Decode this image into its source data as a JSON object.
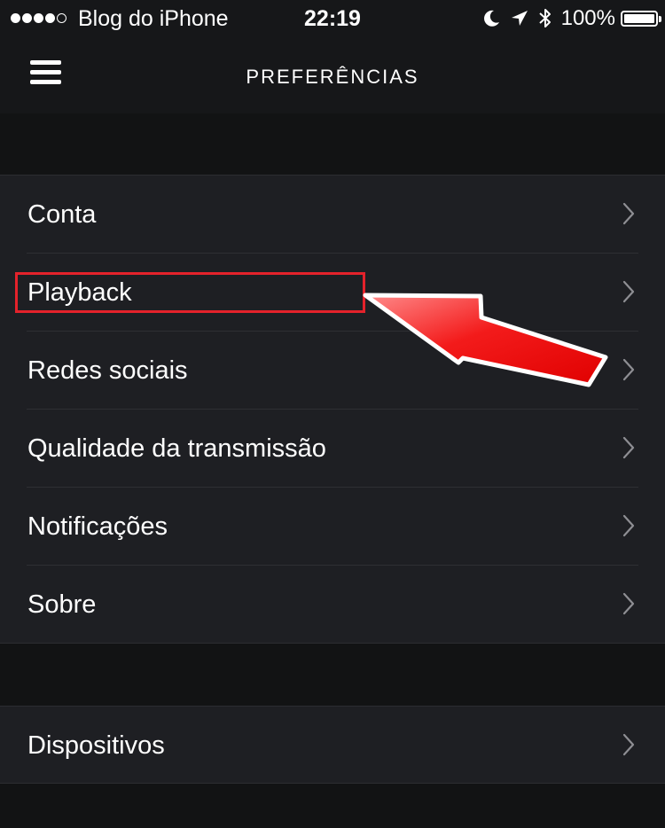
{
  "status_bar": {
    "carrier": "Blog do iPhone",
    "time": "22:19",
    "battery": "100%",
    "battery_level": 1.0,
    "icons": [
      "signal-dots",
      "moon-icon",
      "location-arrow-icon",
      "bluetooth-icon",
      "battery-icon"
    ]
  },
  "nav": {
    "title": "PREFERÊNCIAS",
    "menu_icon": "hamburger-menu-icon"
  },
  "settings": {
    "group1": [
      {
        "label": "Conta"
      },
      {
        "label": "Playback"
      },
      {
        "label": "Redes sociais"
      },
      {
        "label": "Qualidade da transmissão"
      },
      {
        "label": "Notificações"
      },
      {
        "label": "Sobre"
      }
    ],
    "group2": [
      {
        "label": "Dispositivos"
      }
    ]
  },
  "colors": {
    "background": "#121314",
    "bar": "#161719",
    "cell": "#1e1f23",
    "text": "#ffffff",
    "chevron": "#8e8e93",
    "annotation": "#e4222b"
  }
}
